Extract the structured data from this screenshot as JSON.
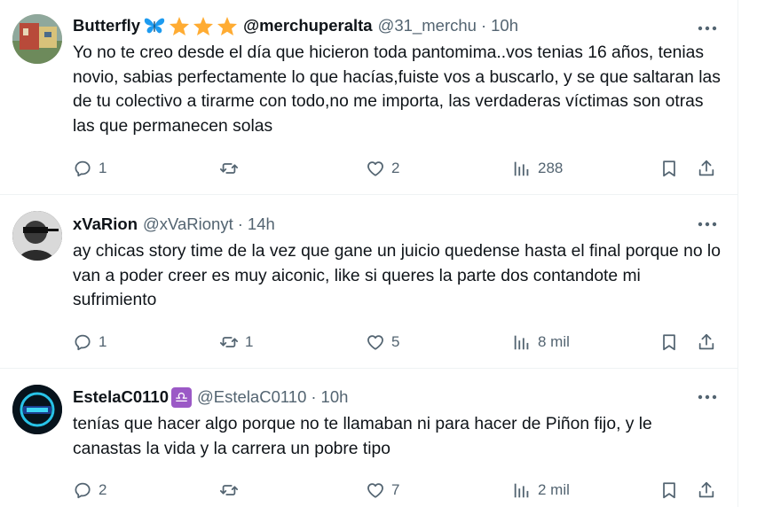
{
  "tweets": [
    {
      "name": "Butterfly",
      "handle": "@31_merchu",
      "time": "10h",
      "name_suffix": "@merchuperalta",
      "emoji_icons": [
        "butterfly-icon",
        "star-icon",
        "star-icon",
        "star-icon"
      ],
      "text": "Yo no te creo desde el día que hicieron toda  pantomima..vos tenias  16 años, tenias novio, sabias perfectamente lo que hacías,fuiste vos a buscarlo, y se que saltaran las de tu colectivo a tirarme con todo,no me importa, las verdaderas víctimas son otras las que permanecen solas",
      "replies": "1",
      "retweets": "",
      "likes": "2",
      "views": "288"
    },
    {
      "name": "xVaRion",
      "handle": "@xVaRionyt",
      "time": "14h",
      "text": "ay chicas story time de la vez que gane un juicio quedense hasta el final porque no lo van a poder creer es muy aiconic, like si queres la parte dos contandote mi sufrimiento",
      "replies": "1",
      "retweets": "1",
      "likes": "5",
      "views": "8 mil"
    },
    {
      "name": "EstelaC0110",
      "handle": "@EstelaC0110",
      "time": "10h",
      "name_emoji": "♎",
      "text": "tenías que hacer algo porque no te llamaban ni para hacer de Piñon fijo, y le canastas la vida y la carrera un pobre tipo",
      "replies": "2",
      "retweets": "",
      "likes": "7",
      "views": "2 mil"
    }
  ],
  "colors": {
    "text_primary": "#0f1419",
    "text_secondary": "#536471",
    "divider": "#eff3f4",
    "butterfly_blue": "#1d9bf0",
    "star_gold": "#ffac33",
    "libra_purple": "#9b59c6"
  }
}
